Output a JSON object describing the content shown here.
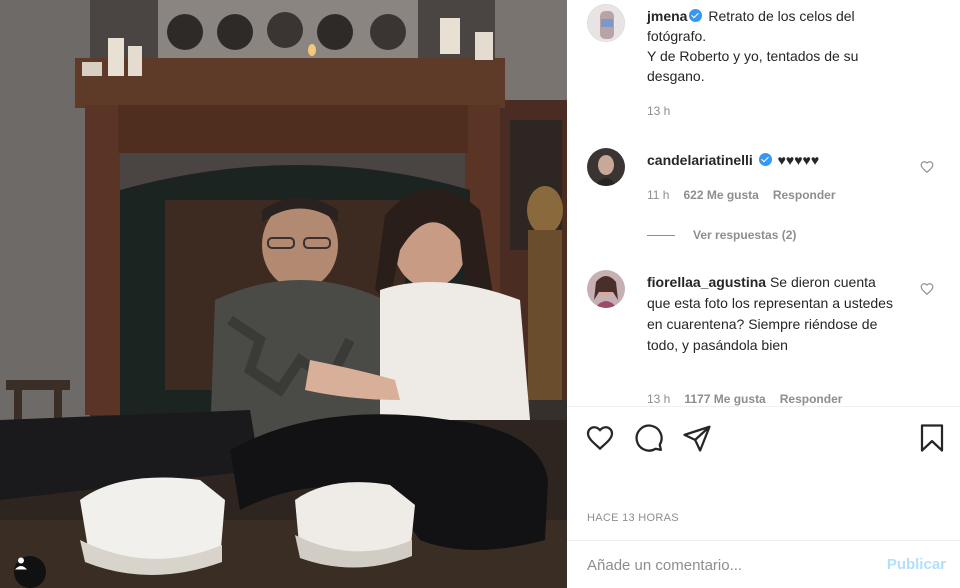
{
  "post": {
    "username": "jmena",
    "caption_lines": [
      "Retrato de los celos del",
      "fotógrafo.",
      "Y de Roberto y yo, tentados de su",
      "desgano."
    ],
    "time": "13 h"
  },
  "comments": [
    {
      "username": "candelariatinelli",
      "verified": true,
      "text": "♥♥♥♥♥",
      "time": "11 h",
      "likes": "622 Me gusta",
      "reply_label": "Responder",
      "view_replies": "Ver respuestas (2)"
    },
    {
      "username": "fiorellaa_agustina",
      "verified": false,
      "text": "Se dieron cuenta que esta foto los representan a ustedes en cuarentena? Siempre riéndose de todo, y pasándola bien",
      "time": "13 h",
      "likes": "1177 Me gusta",
      "reply_label": "Responder"
    }
  ],
  "timestamp_label": "HACE 13 HORAS",
  "add_comment": {
    "placeholder": "Añade un comentario...",
    "publish_label": "Publicar"
  },
  "icons": {
    "like": "heart-icon",
    "comment": "comment-icon",
    "share": "share-icon",
    "save": "bookmark-icon",
    "user_tag": "user-tag-icon"
  },
  "colors": {
    "verified": "#3897f0",
    "muted_text": "#8e8e8e",
    "publish_disabled": "#b2dffc"
  }
}
